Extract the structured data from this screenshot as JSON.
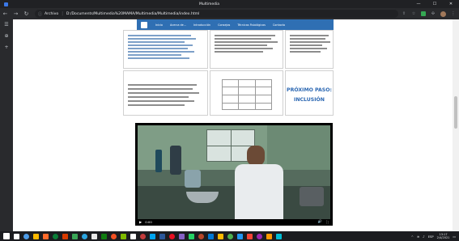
{
  "window": {
    "title": "Multimedia",
    "min_label": "—",
    "max_label": "☐",
    "close_label": "✕"
  },
  "toolbar": {
    "back_icon": "←",
    "forward_icon": "→",
    "reload_icon": "↻",
    "info_icon": "ⓘ",
    "scheme_label": "Archivo",
    "separator": "|",
    "url": "D:/Documents/Multimedia%20MAMA/Multimedia/Multimedia/index.html",
    "menu_icon": "⋮"
  },
  "sidepanel": {
    "icons": [
      "☰",
      "⊕",
      "+"
    ]
  },
  "site": {
    "nav_links": [
      "Inicio",
      "Acerca de...",
      "Introducción",
      "Consejos",
      "Técnicas Fisiológicas",
      "Contacto"
    ]
  },
  "slides": {
    "next_step_title": "PRÓXIMO PASO:",
    "next_step_subtitle": "INCLUSIÓN"
  },
  "video": {
    "play_icon": "▶",
    "time": "0:00",
    "volume_icon": "🔊",
    "fullscreen_icon": "⛶"
  },
  "taskbar": {
    "lang": "ESP",
    "time": "13:17",
    "date": "2/4/2021",
    "colors": [
      "#ffffff",
      "#4c9be8",
      "#ffb900",
      "#ff6a2b",
      "#0a7e38",
      "#d83b01",
      "#3aa757",
      "#2ca5e0",
      "#e8e8e8",
      "#107c10",
      "#f25022",
      "#7fba00",
      "#ffffff",
      "#c33c3c",
      "#00a4ef",
      "#2b579a",
      "#e81123",
      "#8661c5",
      "#25d366",
      "#b7472a",
      "#0078d4",
      "#ffb900",
      "#4caf50",
      "#2196f3",
      "#f44336",
      "#9c27b0",
      "#ff9800",
      "#00bcd4"
    ]
  }
}
